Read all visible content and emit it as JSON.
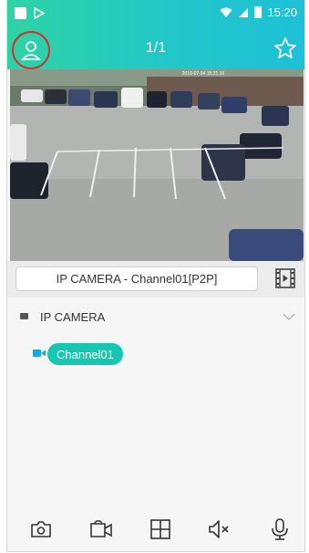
{
  "status_bar": {
    "time": "15:20"
  },
  "app_bar": {
    "page_indicator": "1/1"
  },
  "camera": {
    "timestamp": "2019-07-04 15:21:16"
  },
  "channel_bar": {
    "selected_channel": "IP CAMERA - Channel01[P2P]"
  },
  "device_list": {
    "device_name": "IP CAMERA",
    "channels": [
      "Channel01"
    ]
  },
  "icons": {
    "user": "user-icon",
    "star": "star-icon",
    "playback": "film-play-icon",
    "snapshot": "camera-icon",
    "record": "video-camera-icon",
    "layout": "grid-icon",
    "mute": "speaker-mute-icon",
    "talk": "microphone-icon"
  },
  "colors": {
    "accent": "#17c6b0",
    "header_start": "#2ed3a4",
    "header_end": "#1ec0d6",
    "highlight": "#d62d2d"
  }
}
